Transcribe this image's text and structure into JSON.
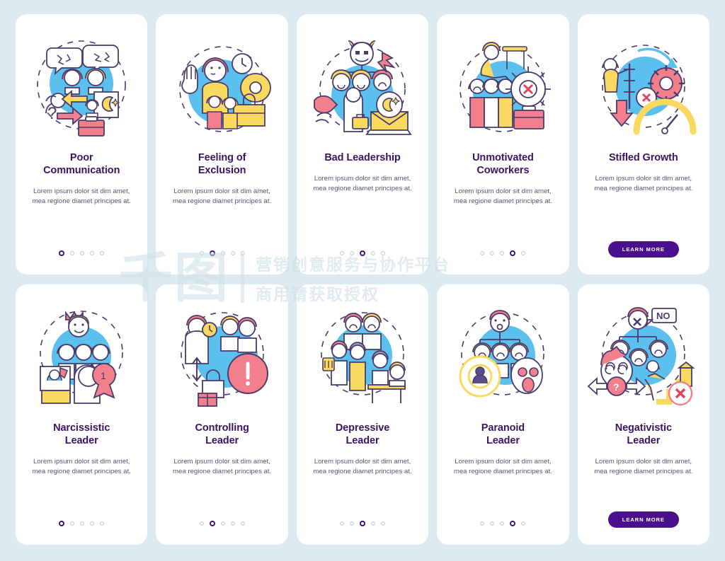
{
  "page": {
    "background_color": "#ddeaef",
    "card_background": "#ffffff",
    "title_color": "#3c1361",
    "body_color": "#5b5475",
    "accent_color": "#4a0f8c",
    "dot_active_color": "#3b1470",
    "dot_inactive_color": "#c9c4d6"
  },
  "shared": {
    "description": "Lorem ipsum dolor sit dim amet, mea regione diamet principes at.",
    "learn_more_label": "LEARN MORE",
    "dot_count": 5
  },
  "rows": [
    {
      "cards": [
        {
          "title_line1": "Poor",
          "title_line2": "Communication",
          "description": "Lorem ipsum dolor sit dim amet, mea regione diamet principes at.",
          "active_dot": 1,
          "has_button": false,
          "illustration": "poor-communication-illustration"
        },
        {
          "title_line1": "Feeling of",
          "title_line2": "Exclusion",
          "description": "Lorem ipsum dolor sit dim amet, mea regione diamet principes at.",
          "active_dot": 2,
          "has_button": false,
          "illustration": "feeling-of-exclusion-illustration"
        },
        {
          "title_line1": "Bad Leadership",
          "title_line2": "",
          "description": "Lorem ipsum dolor sit dim amet, mea regione diamet principes at.",
          "active_dot": 3,
          "has_button": false,
          "illustration": "bad-leadership-illustration"
        },
        {
          "title_line1": "Unmotivated",
          "title_line2": "Coworkers",
          "description": "Lorem ipsum dolor sit dim amet, mea regione diamet principes at.",
          "active_dot": 4,
          "has_button": false,
          "illustration": "unmotivated-coworkers-illustration"
        },
        {
          "title_line1": "Stifled Growth",
          "title_line2": "",
          "description": "Lorem ipsum dolor sit dim amet, mea regione diamet principes at.",
          "active_dot": 0,
          "has_button": true,
          "button_label": "LEARN MORE",
          "illustration": "stifled-growth-illustration"
        }
      ]
    },
    {
      "cards": [
        {
          "title_line1": "Narcissistic",
          "title_line2": "Leader",
          "description": "Lorem ipsum dolor sit dim amet, mea regione diamet principes at.",
          "active_dot": 1,
          "has_button": false,
          "illustration": "narcissistic-leader-illustration"
        },
        {
          "title_line1": "Controlling",
          "title_line2": "Leader",
          "description": "Lorem ipsum dolor sit dim amet, mea regione diamet principes at.",
          "active_dot": 2,
          "has_button": false,
          "illustration": "controlling-leader-illustration"
        },
        {
          "title_line1": "Depressive",
          "title_line2": "Leader",
          "description": "Lorem ipsum dolor sit dim amet, mea regione diamet principes at.",
          "active_dot": 3,
          "has_button": false,
          "illustration": "depressive-leader-illustration"
        },
        {
          "title_line1": "Paranoid",
          "title_line2": "Leader",
          "description": "Lorem ipsum dolor sit dim amet, mea regione diamet principes at.",
          "active_dot": 4,
          "has_button": false,
          "illustration": "paranoid-leader-illustration"
        },
        {
          "title_line1": "Negativistic",
          "title_line2": "Leader",
          "description": "Lorem ipsum dolor sit dim amet, mea regione diamet principes at.",
          "active_dot": 0,
          "has_button": true,
          "button_label": "LEARN MORE",
          "illustration": "negativistic-leader-illustration"
        }
      ]
    }
  ],
  "watermark": {
    "logo": "千图",
    "line1": "营销创意服务与协作平台",
    "line2": "商用请获取授权"
  }
}
